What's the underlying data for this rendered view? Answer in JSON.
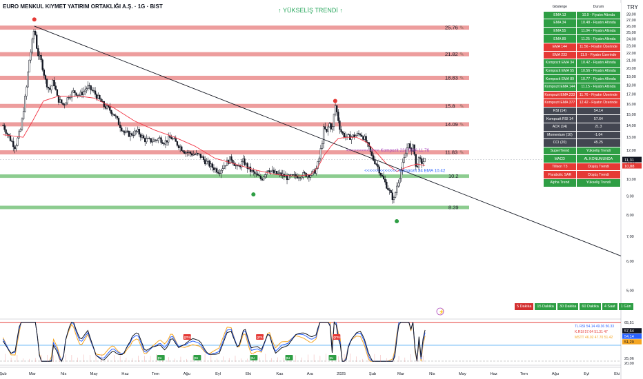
{
  "title": "EURO MENKUL KIYMET YATIRIM ORTAKLIĞI A.Ş. · 1G · BIST",
  "trend_label": "↑ YÜKSELİŞ TRENDİ ↑",
  "currency": "TRY",
  "colors": {
    "candle": "#131722",
    "ema": "#f23645",
    "trendline": "#131722",
    "resistance": "#e57373",
    "support": "#66bb6a",
    "ind_green": "#2e9e44",
    "ind_red": "#e53935",
    "ind_gray": "#434651"
  },
  "table": {
    "headers": [
      "Gösterge",
      "Durum"
    ],
    "rows": [
      {
        "name": "EMA 13",
        "value": "10.9  -  Fiyatın Altında",
        "status": "green"
      },
      {
        "name": "EMA 34",
        "value": "10.48  -  Fiyatın Altında",
        "status": "green"
      },
      {
        "name": "EMA 55",
        "value": "11.04  -  Fiyatın Altında",
        "status": "green"
      },
      {
        "name": "EMA 89",
        "value": "11.25  -  Fiyatın Altında",
        "status": "green"
      },
      {
        "name": "EMA 144",
        "value": "11.56  -  Fiyatın Üzerinde",
        "status": "red"
      },
      {
        "name": "EMA 233",
        "value": "11.9  -  Fiyatın Üzerinde",
        "status": "red"
      },
      {
        "name": "Kompozit EMA 34",
        "value": "10.42  -  Fiyatın Altında",
        "status": "green"
      },
      {
        "name": "Kompozit EMA 55",
        "value": "10.56  -  Fiyatın Altında",
        "status": "green"
      },
      {
        "name": "Kompozit EMA 89",
        "value": "10.77  -  Fiyatın Altında",
        "status": "green"
      },
      {
        "name": "Kompozit EMA 144",
        "value": "11.15  -  Fiyatın Altında",
        "status": "green"
      },
      {
        "name": "Kompozit EMA 233",
        "value": "11.76  -  Fiyatın Üzerinde",
        "status": "red"
      },
      {
        "name": "Kompozit EMA 377",
        "value": "12.42  -  Fiyatın Üzerinde",
        "status": "red"
      },
      {
        "name": "RSI (14)",
        "value": "54.14",
        "status": "gray"
      },
      {
        "name": "Kompozit RSI 14",
        "value": "57.64",
        "status": "gray"
      },
      {
        "name": "ADX (14)",
        "value": "21.3",
        "status": "gray"
      },
      {
        "name": "Momentum (10)",
        "value": "-1.04",
        "status": "gray"
      },
      {
        "name": "CCI (20)",
        "value": "45.25",
        "status": "gray"
      },
      {
        "name": "SuperTrend",
        "value": "Yükseliş Trendi",
        "status": "green"
      },
      {
        "name": "MACD",
        "value": "AL KONUMUNDA",
        "status": "green"
      },
      {
        "name": "Tillson T3",
        "value": "Düşüş Trendi",
        "status": "red"
      },
      {
        "name": "Parabolic SAR",
        "value": "Düşüş Trendi",
        "status": "red"
      },
      {
        "name": "Alpha Trend",
        "value": "Yükseliş Trendi",
        "status": "green"
      }
    ]
  },
  "timeframes": [
    {
      "label": "5 Dakika",
      "active": true
    },
    {
      "label": "15 Dakika",
      "active": false
    },
    {
      "label": "30 Dakika",
      "active": false
    },
    {
      "label": "60 Dakika",
      "active": false
    },
    {
      "label": "4 Saat",
      "active": false
    },
    {
      "label": "1 Gün",
      "active": false
    }
  ],
  "indicator_legend": [
    {
      "text": "TL RSI  54.14  49.36  50.33",
      "color": "#2962ff"
    },
    {
      "text": "K.RSI  57.64  51.31  47",
      "color": "#e53935"
    },
    {
      "text": "MSTT  46.02  47.70  51.42",
      "color": "#f5a623"
    }
  ],
  "chart_data": {
    "type": "candlestick",
    "title": "EURO MENKUL KIYMET YATIRIM ORTAKLIĞI A.Ş. · 1G · BIST",
    "x_axis": {
      "ticks": [
        {
          "label": "Şub",
          "d": 0
        },
        {
          "label": "Mar",
          "d": 29
        },
        {
          "label": "Nis",
          "d": 60
        },
        {
          "label": "May",
          "d": 90
        },
        {
          "label": "Haz",
          "d": 121
        },
        {
          "label": "Tem",
          "d": 151
        },
        {
          "label": "Ağu",
          "d": 182
        },
        {
          "label": "Eyl",
          "d": 213
        },
        {
          "label": "Eki",
          "d": 243
        },
        {
          "label": "Kas",
          "d": 274
        },
        {
          "label": "Ara",
          "d": 304
        },
        {
          "label": "2025",
          "d": 335
        },
        {
          "label": "Şub",
          "d": 366
        },
        {
          "label": "Mar",
          "d": 394
        },
        {
          "label": "Nis",
          "d": 425
        },
        {
          "label": "May",
          "d": 455
        },
        {
          "label": "Haz",
          "d": 486
        },
        {
          "label": "Tem",
          "d": 516
        },
        {
          "label": "Ağu",
          "d": 547
        },
        {
          "label": "Eyl",
          "d": 578
        },
        {
          "label": "Eki",
          "d": 608
        }
      ],
      "range_days": [
        -3,
        612
      ]
    },
    "y_axis": {
      "scale": "log",
      "range": [
        4.2,
        30.6
      ],
      "ticks": [
        5,
        6,
        7,
        8,
        9,
        10,
        11,
        12,
        13,
        14,
        15,
        16,
        17,
        18,
        19,
        20,
        21,
        22,
        23,
        24,
        25,
        26,
        27,
        28
      ],
      "tick_labels": [
        "5,00",
        "6,00",
        "7,00",
        "8,00",
        "9,00",
        "10,00",
        "11,00",
        "12,00",
        "13,00",
        "14,00",
        "15,00",
        "16,00",
        "17,00",
        "18,00",
        "19,00",
        "20,00",
        "21,00",
        "22,00",
        "23,00",
        "24,00",
        "25,00",
        "26,00",
        "27,00",
        "28,00"
      ]
    },
    "price_path": [
      [
        0,
        14.0
      ],
      [
        6,
        13.0
      ],
      [
        12,
        12.2
      ],
      [
        18,
        13.8
      ],
      [
        23,
        17.5
      ],
      [
        26,
        21
      ],
      [
        28,
        22.5
      ],
      [
        31,
        25.8
      ],
      [
        34,
        22
      ],
      [
        38,
        20.8
      ],
      [
        42,
        18.5
      ],
      [
        46,
        17.4
      ],
      [
        50,
        18.5
      ],
      [
        54,
        16.5
      ],
      [
        60,
        15.9
      ],
      [
        65,
        16.8
      ],
      [
        70,
        17.3
      ],
      [
        76,
        16.9
      ],
      [
        84,
        17.8
      ],
      [
        90,
        17.2
      ],
      [
        95,
        16.5
      ],
      [
        100,
        15.8
      ],
      [
        105,
        15.5
      ],
      [
        110,
        15.0
      ],
      [
        115,
        14.1
      ],
      [
        120,
        13.4
      ],
      [
        126,
        13.2
      ],
      [
        133,
        13.5
      ],
      [
        140,
        12.8
      ],
      [
        148,
        12.7
      ],
      [
        155,
        12.9
      ],
      [
        160,
        12.6
      ],
      [
        166,
        13.0
      ],
      [
        172,
        12.5
      ],
      [
        180,
        11.9
      ],
      [
        188,
        11.7
      ],
      [
        195,
        11.6
      ],
      [
        200,
        11.2
      ],
      [
        207,
        10.8
      ],
      [
        214,
        10.5
      ],
      [
        220,
        11.0
      ],
      [
        226,
        11.4
      ],
      [
        232,
        10.7
      ],
      [
        238,
        11.2
      ],
      [
        244,
        10.6
      ],
      [
        250,
        10.3
      ],
      [
        256,
        10.0
      ],
      [
        262,
        10.7
      ],
      [
        268,
        10.4
      ],
      [
        275,
        10.3
      ],
      [
        282,
        10.1
      ],
      [
        290,
        10.2
      ],
      [
        298,
        10.3
      ],
      [
        305,
        10.3
      ],
      [
        310,
        10.6
      ],
      [
        313,
        11.3
      ],
      [
        316,
        12.6
      ],
      [
        318,
        14.0
      ],
      [
        320,
        13.2
      ],
      [
        323,
        14.2
      ],
      [
        326,
        13.6
      ],
      [
        329,
        15.9
      ],
      [
        331,
        15.0
      ],
      [
        334,
        13.6
      ],
      [
        337,
        13.2
      ],
      [
        342,
        13.0
      ],
      [
        348,
        13.1
      ],
      [
        354,
        13.3
      ],
      [
        358,
        12.9
      ],
      [
        362,
        12.2
      ],
      [
        366,
        11.4
      ],
      [
        370,
        11.0
      ],
      [
        375,
        10.2
      ],
      [
        380,
        9.6
      ],
      [
        384,
        9.1
      ],
      [
        387,
        8.8
      ],
      [
        390,
        9.6
      ],
      [
        393,
        10.2
      ],
      [
        396,
        11.0
      ],
      [
        399,
        11.8
      ],
      [
        402,
        12.8
      ],
      [
        404,
        11.4
      ],
      [
        406,
        12.6
      ],
      [
        409,
        10.7
      ],
      [
        412,
        11.3
      ],
      [
        415,
        11.1
      ],
      [
        418,
        11.31
      ]
    ],
    "ema": [
      [
        0,
        13.2
      ],
      [
        20,
        13.0
      ],
      [
        30,
        14.5
      ],
      [
        40,
        16.3
      ],
      [
        55,
        16.8
      ],
      [
        75,
        16.8
      ],
      [
        90,
        16.6
      ],
      [
        110,
        15.6
      ],
      [
        130,
        14.4
      ],
      [
        150,
        13.6
      ],
      [
        170,
        13.0
      ],
      [
        190,
        12.3
      ],
      [
        210,
        11.4
      ],
      [
        230,
        11.0
      ],
      [
        250,
        10.6
      ],
      [
        270,
        10.3
      ],
      [
        290,
        10.2
      ],
      [
        305,
        10.3
      ],
      [
        312,
        10.8
      ],
      [
        318,
        11.6
      ],
      [
        325,
        12.3
      ],
      [
        332,
        12.9
      ],
      [
        340,
        13.0
      ],
      [
        350,
        13.0
      ],
      [
        360,
        12.6
      ],
      [
        370,
        11.8
      ],
      [
        380,
        11.0
      ],
      [
        390,
        10.5
      ],
      [
        400,
        10.8
      ],
      [
        410,
        11.0
      ],
      [
        418,
        10.9
      ]
    ],
    "trendline": [
      [
        31,
        26.0
      ],
      [
        612,
        6.2
      ]
    ],
    "resistance_levels": [
      25.76,
      21.82,
      18.83,
      15.8,
      14.09,
      11.83
    ],
    "resistance_labels": [
      "25.76",
      "21.82",
      "18.83",
      "15.8",
      "14.09",
      "11.83"
    ],
    "support_levels": [
      10.2,
      8.39
    ],
    "support_labels": [
      "10.2",
      "8.39"
    ],
    "markers": [
      {
        "d": 31,
        "y": 27.1,
        "color": "#e53935"
      },
      {
        "d": 329,
        "y": 16.3,
        "color": "#e53935"
      },
      {
        "d": 248,
        "y": 9.1,
        "color": "#2e9e44"
      },
      {
        "d": 390,
        "y": 7.7,
        "color": "#2e9e44"
      }
    ],
    "annotations": [
      {
        "text": "<<<<<<<<<<<<< Kompozit 233 EMA 11.76",
        "d": 340,
        "y": 12.0,
        "color": "#ab47bc"
      },
      {
        "text": "<<<<<<<<<<<<< Kompozit 34 EMA 10.42",
        "d": 358,
        "y": 10.55,
        "color": "#2962ff"
      }
    ],
    "price_labels": [
      {
        "text": "11,31",
        "y": 11.31,
        "bg": "#131722"
      },
      {
        "text": "10,88",
        "y": 10.88,
        "bg": "#e53935"
      }
    ],
    "oscillator": {
      "right_axis": [
        {
          "text": "65,51",
          "bg": "#ffffff",
          "color": "#131722"
        },
        {
          "text": "57,64",
          "bg": "#131722",
          "color": "#ffffff"
        },
        {
          "text": "54,14",
          "bg": "#2962ff",
          "color": "#ffffff"
        },
        {
          "text": "51,29",
          "bg": "#f5a623",
          "color": "#131722"
        },
        {
          "text": "25,06",
          "bg": "#ffffff",
          "color": "#131722"
        },
        {
          "text": "20,00",
          "bg": "#ffffff",
          "color": "#131722"
        }
      ],
      "signals": [
        {
          "d": 182,
          "label": "gmu",
          "color": "#e53935"
        },
        {
          "d": 254,
          "label": "gmu",
          "color": "#e53935"
        },
        {
          "d": 330,
          "label": "gmu",
          "color": "#e53935"
        },
        {
          "d": 156,
          "label": "pu",
          "color": "#2e9e44"
        },
        {
          "d": 192,
          "label": "pu",
          "color": "#2e9e44"
        },
        {
          "d": 248,
          "label": "pu",
          "color": "#2e9e44"
        },
        {
          "d": 283,
          "label": "pu",
          "color": "#2e9e44"
        },
        {
          "d": 326,
          "label": "pu",
          "color": "#2e9e44"
        }
      ]
    }
  }
}
